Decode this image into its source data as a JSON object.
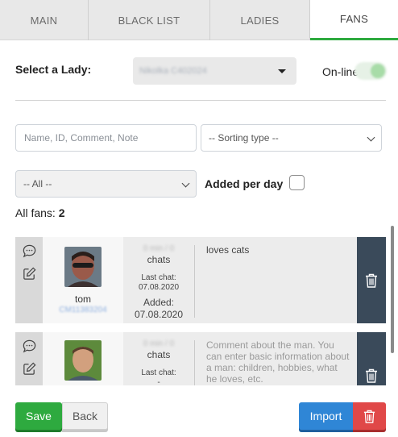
{
  "tabs": [
    {
      "label": "MAIN"
    },
    {
      "label": "BLACK LIST"
    },
    {
      "label": "LADIES"
    },
    {
      "label": "FANS",
      "active": true
    }
  ],
  "lady_selector": {
    "label": "Select a Lady:",
    "value": "Nikolka C402024"
  },
  "online": {
    "label": "On-line",
    "enabled": true
  },
  "filters": {
    "search_placeholder": "Name, ID, Comment, Note",
    "sorting_value": "-- Sorting type --",
    "category_value": "-- All --",
    "added_per_day_label": "Added per day",
    "added_per_day_checked": false
  },
  "summary": {
    "label": "All fans:",
    "count": "2"
  },
  "fans": [
    {
      "chats_count": "0 min / 0",
      "chats_label": "chats",
      "last_chat_label": "Last chat:",
      "last_chat_date": "07.08.2020",
      "added_label": "Added:",
      "added_date": "07.08.2020",
      "name": "tom",
      "id": "CM11383204",
      "comment": "loves cats"
    },
    {
      "chats_count": "0 min / 0",
      "chats_label": "chats",
      "last_chat_label": "Last chat:",
      "last_chat_date": "-",
      "comment_placeholder": "Comment about the man. You can enter basic information about a man: children, hobbies, what he loves, etc."
    }
  ],
  "footer": {
    "save_label": "Save",
    "back_label": "Back",
    "import_label": "Import"
  },
  "colors": {
    "accent_green": "#2eaa3f",
    "import_blue": "#2f86d6",
    "delete_red": "#e04848",
    "delete_dark": "#3a4a5a"
  },
  "icons": [
    "chat-bubble-icon",
    "edit-icon",
    "trash-icon",
    "chevron-down-icon"
  ]
}
